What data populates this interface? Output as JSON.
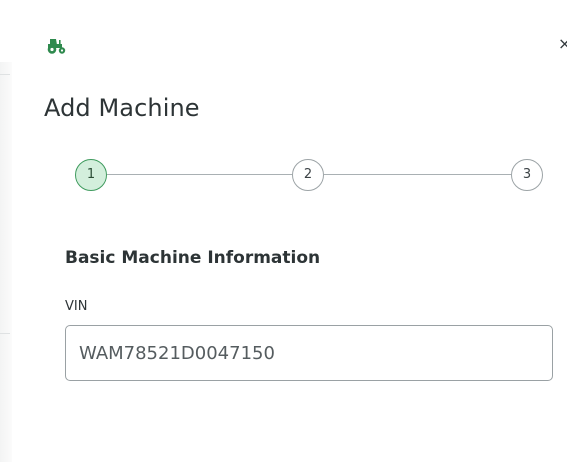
{
  "header": {
    "icon": "tractor-icon",
    "close_icon": "close-icon",
    "close_glyph": "×"
  },
  "title": "Add Machine",
  "stepper": {
    "current_step": 1,
    "steps": [
      {
        "label": "1",
        "active": true
      },
      {
        "label": "2",
        "active": false
      },
      {
        "label": "3",
        "active": false
      }
    ]
  },
  "section": {
    "title": "Basic Machine Information"
  },
  "vin_field": {
    "label": "VIN",
    "value": "WAM78521D0047150"
  },
  "colors": {
    "accent": "#3f9b5e",
    "step_active_fill": "#d3efdc",
    "text": "#2d3436",
    "border": "#9aa1a4"
  }
}
